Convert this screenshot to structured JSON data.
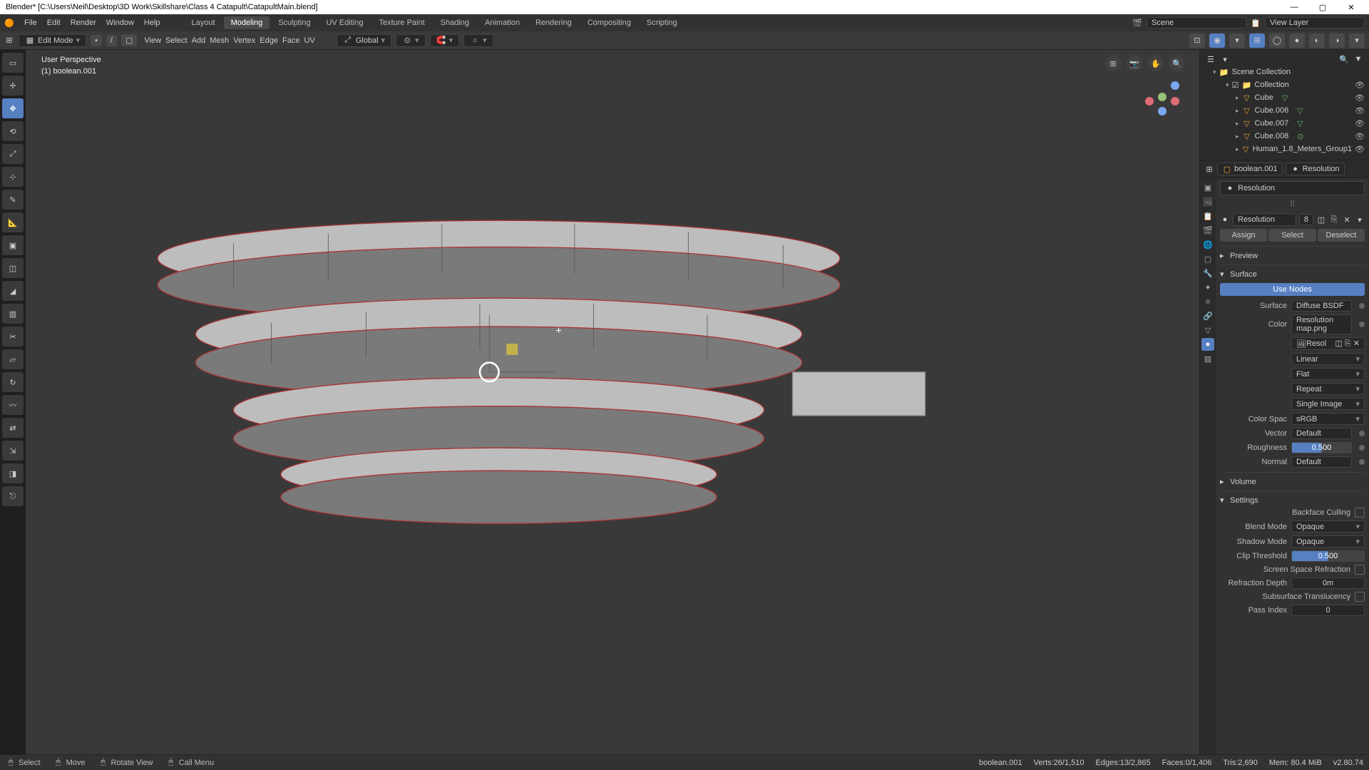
{
  "title": "Blender* [C:\\Users\\Neil\\Desktop\\3D Work\\Skillshare\\Class 4 Catapult\\CatapultMain.blend]",
  "win": {
    "min": "—",
    "max": "▢",
    "close": "✕"
  },
  "menu": {
    "file": "File",
    "edit": "Edit",
    "render": "Render",
    "window": "Window",
    "help": "Help"
  },
  "workspaces": {
    "layout": "Layout",
    "modeling": "Modeling",
    "sculpting": "Sculpting",
    "uv": "UV Editing",
    "tex": "Texture Paint",
    "shading": "Shading",
    "anim": "Animation",
    "rendering": "Rendering",
    "comp": "Compositing",
    "scripting": "Scripting"
  },
  "topright": {
    "sceneLabel": "Scene",
    "viewLayerLabel": "View Layer"
  },
  "hdr": {
    "mode": "Edit Mode",
    "view": "View",
    "select": "Select",
    "add": "Add",
    "mesh": "Mesh",
    "vertex": "Vertex",
    "edge": "Edge",
    "face": "Face",
    "uv": "UV",
    "orient": "Global"
  },
  "viewport": {
    "persp": "User Perspective",
    "objline": "(1)  boolean.001"
  },
  "outliner": {
    "root": "Scene Collection",
    "coll": "Collection",
    "items": [
      "Cube",
      "Cube.006",
      "Cube.007",
      "Cube.008",
      "Human_1.8_Meters_Group1"
    ]
  },
  "path": {
    "obj": "boolean.001",
    "mat": "Resolution"
  },
  "mat": {
    "name": "Resolution",
    "slotName": "Resolution",
    "slotIndex": "8",
    "assign": "Assign",
    "select": "Select",
    "deselect": "Deselect",
    "preview": "Preview",
    "surface": "Surface",
    "volume": "Volume",
    "settings": "Settings",
    "useNodes": "Use Nodes",
    "surfaceLbl": "Surface",
    "surfaceVal": "Diffuse BSDF",
    "colorLbl": "Color",
    "colorVal": "Resolution map.png",
    "resolLbl": "Resol",
    "linear": "Linear",
    "flat": "Flat",
    "repeat": "Repeat",
    "single": "Single Image",
    "cspaceLbl": "Color Spac",
    "cspaceVal": "sRGB",
    "vectorLbl": "Vector",
    "vectorVal": "Default",
    "roughLbl": "Roughness",
    "roughVal": "0.500",
    "normalLbl": "Normal",
    "normalVal": "Default",
    "backface": "Backface Culling",
    "blendLbl": "Blend Mode",
    "blendVal": "Opaque",
    "shadowLbl": "Shadow Mode",
    "shadowVal": "Opaque",
    "clipLbl": "Clip Threshold",
    "clipVal": "0.500",
    "ssr": "Screen Space Refraction",
    "refdepthLbl": "Refraction Depth",
    "refdepthVal": "0m",
    "sss": "Subsurface Translucency",
    "passLbl": "Pass Index",
    "passVal": "0"
  },
  "status": {
    "select": "Select",
    "move": "Move",
    "rotate": "Rotate View",
    "call": "Call Menu",
    "obj": "boolean.001",
    "verts": "Verts:26/1,510",
    "edges": "Edges:13/2,865",
    "faces": "Faces:0/1,406",
    "tris": "Tris:2,690",
    "mem": "Mem: 80.4 MiB",
    "ver": "v2.80.74"
  }
}
